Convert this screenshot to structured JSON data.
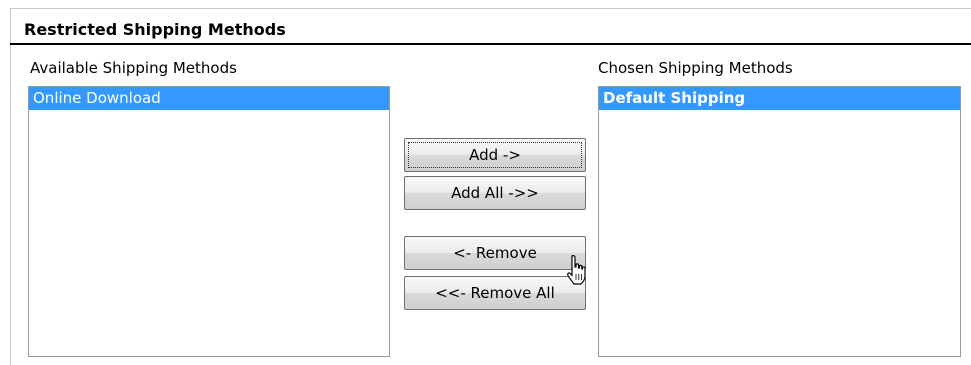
{
  "section": {
    "title": "Restricted Shipping Methods"
  },
  "available": {
    "label": "Available Shipping Methods",
    "items": [
      "Online Download"
    ]
  },
  "chosen": {
    "label": "Chosen Shipping Methods",
    "items": [
      "Default Shipping"
    ]
  },
  "buttons": {
    "add": "Add ->",
    "add_all": "Add All ->>",
    "remove": "<- Remove",
    "remove_all": "<<- Remove All"
  },
  "colors": {
    "selection": "#3399ff",
    "header_rule": "#000000",
    "button_border": "#6f6f6f"
  },
  "icons": {
    "cursor": "hand-pointer-icon"
  }
}
